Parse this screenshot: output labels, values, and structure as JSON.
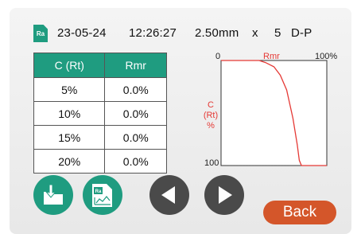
{
  "header": {
    "badge": "Ra",
    "date": "23-05-24",
    "time": "12:26:27",
    "length": "2.50mm",
    "x_sign": "x",
    "count": "5",
    "filter": "D-P"
  },
  "table": {
    "headers": [
      "C (Rt)",
      "Rmr"
    ],
    "rows": [
      [
        "5%",
        "0.0%"
      ],
      [
        "10%",
        "0.0%"
      ],
      [
        "15%",
        "0.0%"
      ],
      [
        "20%",
        "0.0%"
      ]
    ]
  },
  "chart_data": {
    "type": "line",
    "title": "Rmr",
    "x_axis": {
      "label": "Rmr",
      "range": [
        0,
        100
      ],
      "tick_labels": [
        "0",
        "100%"
      ]
    },
    "y_axis": {
      "label": [
        "C",
        "(Rt)",
        "%"
      ],
      "range": [
        0,
        100
      ],
      "inverted": true,
      "tick_labels": [
        "0",
        "100"
      ]
    },
    "series": [
      {
        "color": "#e53935",
        "x": [
          0,
          36,
          42,
          50,
          56,
          62,
          68,
          72,
          74,
          76,
          100
        ],
        "y": [
          0,
          0,
          2,
          6,
          14,
          28,
          55,
          80,
          95,
          100,
          100
        ]
      }
    ]
  },
  "buttons": {
    "back_label": "Back",
    "icon_badge": "Ra"
  },
  "colors": {
    "accent": "#1f9c80",
    "curve": "#e53935",
    "back": "#d4562a",
    "nav": "#4a4a4a"
  }
}
